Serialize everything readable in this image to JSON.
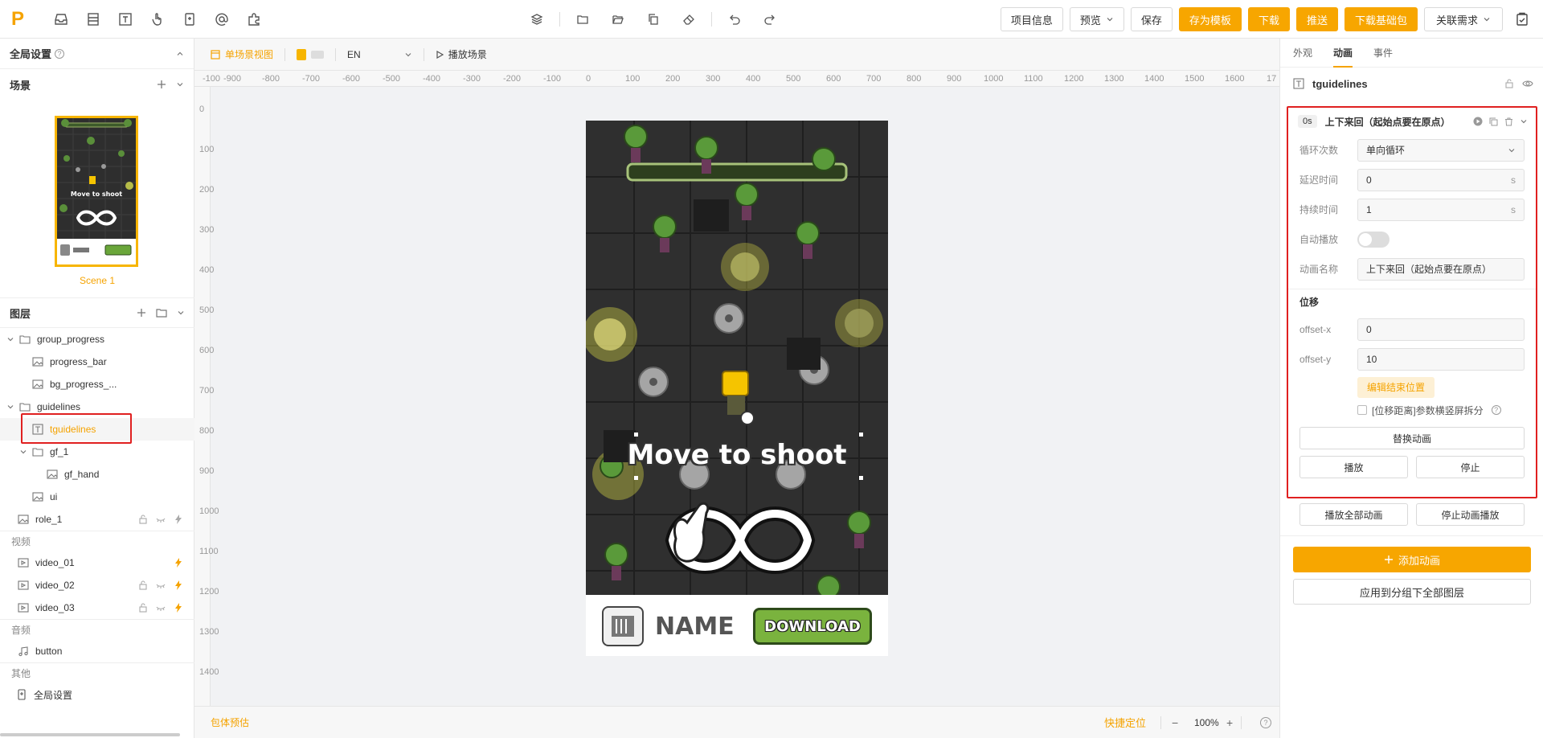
{
  "topbar": {
    "logo": "P",
    "buttons": {
      "project_info": "项目信息",
      "preview": "预览",
      "save": "保存",
      "save_template": "存为模板",
      "download": "下载",
      "push": "推送",
      "download_base": "下载基础包",
      "related_req": "关联需求"
    }
  },
  "left": {
    "global_settings": "全局设置",
    "scene_section": "场景",
    "scene_name": "Scene 1",
    "scene_thumb_text": "Move to shoot",
    "layers_section": "图层",
    "layers": [
      {
        "name": "group_progress",
        "type": "folder",
        "indent": 0,
        "caret": true
      },
      {
        "name": "progress_bar",
        "type": "image",
        "indent": 1
      },
      {
        "name": "bg_progress_...",
        "type": "image",
        "indent": 1
      },
      {
        "name": "guidelines",
        "type": "folder",
        "indent": 0,
        "caret": true
      },
      {
        "name": "tguidelines",
        "type": "text",
        "indent": 1,
        "selected": true
      },
      {
        "name": "gf_1",
        "type": "folder",
        "indent": 1,
        "caret": true
      },
      {
        "name": "gf_hand",
        "type": "image",
        "indent": 2
      },
      {
        "name": "ui",
        "type": "image",
        "indent": 1
      },
      {
        "name": "role_1",
        "type": "image",
        "indent": 0
      }
    ],
    "video_section": "视频",
    "videos": [
      "video_01",
      "video_02",
      "video_03"
    ],
    "audio_section": "音频",
    "audios": [
      "button"
    ],
    "other_section": "其他",
    "others": [
      "全局设置"
    ]
  },
  "canvas": {
    "toolbar": {
      "single_scene_view": "单场景视图",
      "language": "EN",
      "play_scene": "播放场景"
    },
    "ruler_x": [
      "-100",
      "-900",
      "-800",
      "-700",
      "-600",
      "-500",
      "-400",
      "-300",
      "-200",
      "-100",
      "0",
      "100",
      "200",
      "300",
      "400",
      "500",
      "600",
      "700",
      "800",
      "900",
      "1000",
      "1100",
      "1200",
      "1300",
      "1400",
      "1500",
      "1600",
      "17"
    ],
    "ruler_y": [
      "0",
      "100",
      "200",
      "300",
      "400",
      "500",
      "600",
      "700",
      "800",
      "900",
      "1000",
      "1100",
      "1200",
      "1300",
      "1400"
    ],
    "stage": {
      "headline": "Move to shoot",
      "app_name": "NAME",
      "download_label": "DOWNLOAD"
    },
    "status": {
      "estimate": "包体预估",
      "quick_locate": "快捷定位",
      "zoom": "100%"
    }
  },
  "right": {
    "tabs": [
      "外观",
      "动画",
      "事件"
    ],
    "active_tab": "动画",
    "element_name": "tguidelines",
    "animation": {
      "time": "0s",
      "title": "上下来回（起始点要在原点）",
      "loop_label": "循环次数",
      "loop_value": "单向循环",
      "delay_label": "延迟时间",
      "delay_value": "0",
      "delay_unit": "s",
      "duration_label": "持续时间",
      "duration_value": "1",
      "duration_unit": "s",
      "autoplay_label": "自动播放",
      "name_label": "动画名称",
      "name_value": "上下来回（起始点要在原点）",
      "displacement_title": "位移",
      "offset_x_label": "offset-x",
      "offset_x_value": "0",
      "offset_y_label": "offset-y",
      "offset_y_value": "10",
      "edit_end_pos": "编辑结束位置",
      "split_label": "[位移距离]参数横竖屏拆分",
      "replace_anim": "替换动画",
      "play": "播放",
      "stop": "停止"
    },
    "play_all": "播放全部动画",
    "stop_all": "停止动画播放",
    "add_anim": "添加动画",
    "apply_group": "应用到分组下全部图层"
  }
}
